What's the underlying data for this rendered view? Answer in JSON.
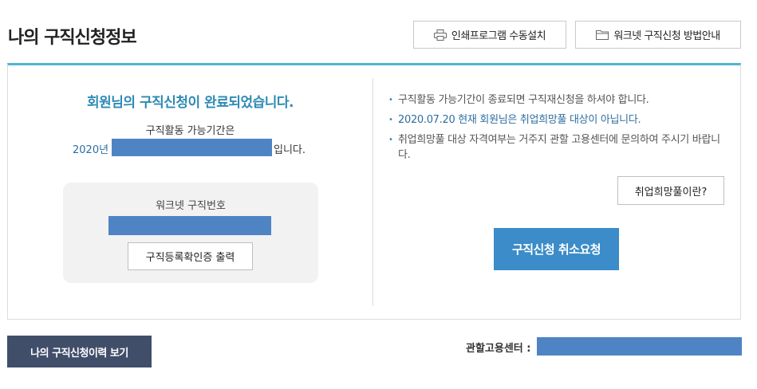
{
  "header": {
    "title": "나의 구직신청정보",
    "print_button": "인쇄프로그램 수동설치",
    "guide_button": "워크넷 구직신청 방법안내"
  },
  "status": {
    "complete_message": "회원님의 구직신청이 완료되었습니다.",
    "period_label": "구직활동 가능기간은",
    "period_year": "2020년",
    "period_suffix": "입니다."
  },
  "worknet_id": {
    "label": "워크넷 구직번호",
    "cert_button": "구직등록확인증 출력"
  },
  "notes": [
    "구직활동 가능기간이 종료되면 구직재신청을 하셔야 합니다.",
    "2020.07.20 현재 회원님은 취업희망풀 대상이 아닙니다.",
    "취업희망풀 대상 자격여부는 거주지 관할 고용센터에 문의하여 주시기 바랍니다."
  ],
  "actions": {
    "what_is_pool_button": "취업희망풀이란?",
    "cancel_button": "구직신청 취소요청",
    "history_button": "나의 구직신청이력 보기"
  },
  "footer": {
    "center_label": "관할고용센터 :"
  },
  "colors": {
    "accent": "#4fb3d6",
    "primary_button": "#3b8cc8",
    "dark_button": "#404e6a",
    "redaction": "#4f84c4"
  }
}
